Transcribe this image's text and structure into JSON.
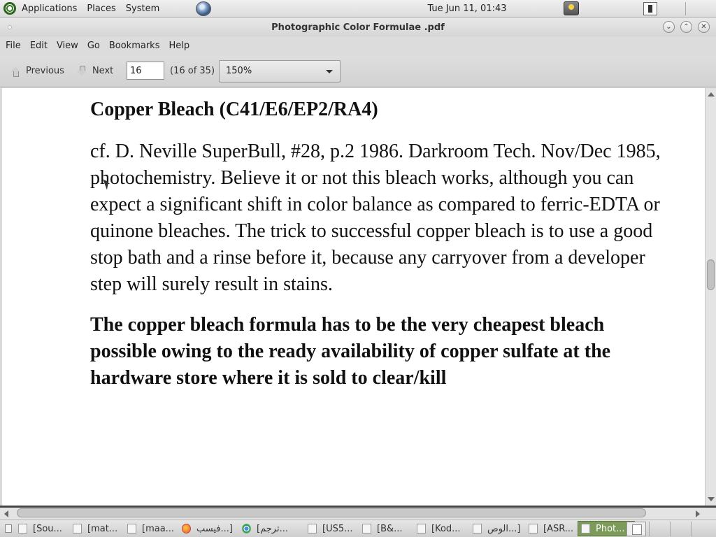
{
  "top_panel": {
    "menus": [
      "Applications",
      "Places",
      "System"
    ],
    "clock": "Tue Jun 11, 01:43"
  },
  "window": {
    "title": "Photographic Color Formulae .pdf"
  },
  "menubar": [
    "File",
    "Edit",
    "View",
    "Go",
    "Bookmarks",
    "Help"
  ],
  "toolbar": {
    "previous_label": "Previous",
    "next_label": "Next",
    "page_value": "16",
    "page_count": "(16 of 35)",
    "zoom_value": "150%"
  },
  "document": {
    "heading": "Copper Bleach (C41/E6/EP2/RA4)",
    "paragraph": "cf. D. Neville SuperBull, #28, p.2 1986.  Darkroom Tech. Nov/Dec 1985, photochemistry.  Believe it or not this bleach works, although you can expect a significant shift in color balance as compared to ferric-EDTA or quinone bleaches.  The trick to successful copper bleach is to use a good stop bath and a rinse before it, because any carryover from a developer step will surely result in stains.",
    "bold_paragraph": "The copper bleach formula has to be the very cheapest bleach possible owing to the ready availability of copper sulfate at the hardware store where it is sold to clear/kill"
  },
  "scroll": {
    "vertical_position": 0.44,
    "horizontal_position": 0.0
  },
  "taskbar": {
    "tasks": [
      {
        "label": "[Sou...",
        "icon": "document-icon",
        "active": false
      },
      {
        "label": "[mat...",
        "icon": "document-icon",
        "active": false
      },
      {
        "label": "[maa...",
        "icon": "document-icon",
        "active": false
      },
      {
        "label": "فيسب...]",
        "icon": "firefox-icon",
        "active": false
      },
      {
        "label": "[ترجم...",
        "icon": "chrome-icon",
        "active": false
      },
      {
        "label": "[US5...",
        "icon": "document-icon",
        "active": false
      },
      {
        "label": "[B&...",
        "icon": "document-icon",
        "active": false
      },
      {
        "label": "[Kod...",
        "icon": "document-icon",
        "active": false
      },
      {
        "label": "الوص...]",
        "icon": "document-icon",
        "active": false
      },
      {
        "label": "[ASR...",
        "icon": "document-icon",
        "active": false
      },
      {
        "label": "Phot...",
        "icon": "document-icon",
        "active": true
      }
    ]
  },
  "colors": {
    "active_task": "#7c9b5a",
    "document_background": "#ffffff",
    "chrome_background": "#dcdcdc"
  }
}
